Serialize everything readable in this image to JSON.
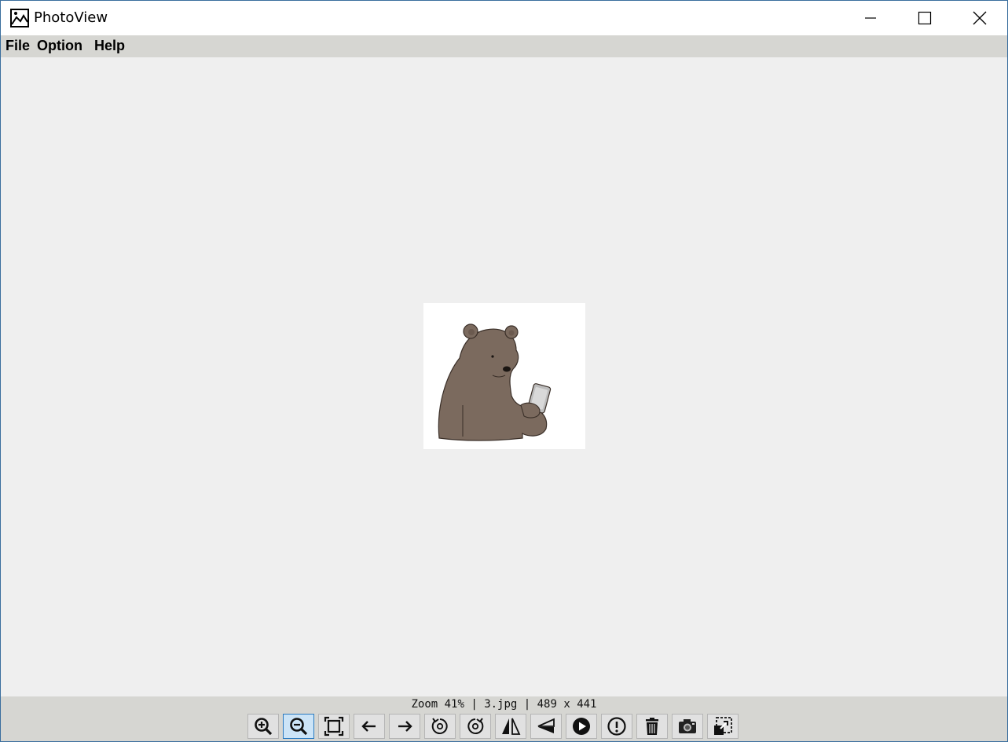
{
  "window": {
    "title": "PhotoView"
  },
  "icons": {
    "app": "photo-icon",
    "minimize": "minimize-icon",
    "maximize": "maximize-icon",
    "close": "close-icon"
  },
  "menu": {
    "items": [
      "File",
      "Option",
      "Help"
    ]
  },
  "image": {
    "subject": "bear-holding-phone"
  },
  "status": {
    "text": "Zoom 41% | 3.jpg | 489 x 441"
  },
  "toolbar": {
    "buttons": [
      {
        "icon": "zoom-in-icon"
      },
      {
        "icon": "zoom-out-icon",
        "active": true
      },
      {
        "icon": "fit-to-window-icon"
      },
      {
        "icon": "arrow-left-icon"
      },
      {
        "icon": "arrow-right-icon"
      },
      {
        "icon": "rotate-left-icon"
      },
      {
        "icon": "rotate-right-icon"
      },
      {
        "icon": "flip-horizontal-icon"
      },
      {
        "icon": "flip-vertical-icon"
      },
      {
        "icon": "play-icon"
      },
      {
        "icon": "info-icon"
      },
      {
        "icon": "trash-icon"
      },
      {
        "icon": "camera-icon"
      },
      {
        "icon": "crop-icon"
      }
    ]
  },
  "colors": {
    "bear": "#7b6a5e",
    "bear_outline": "#3a2f28",
    "active_button": "#cce4f7"
  }
}
